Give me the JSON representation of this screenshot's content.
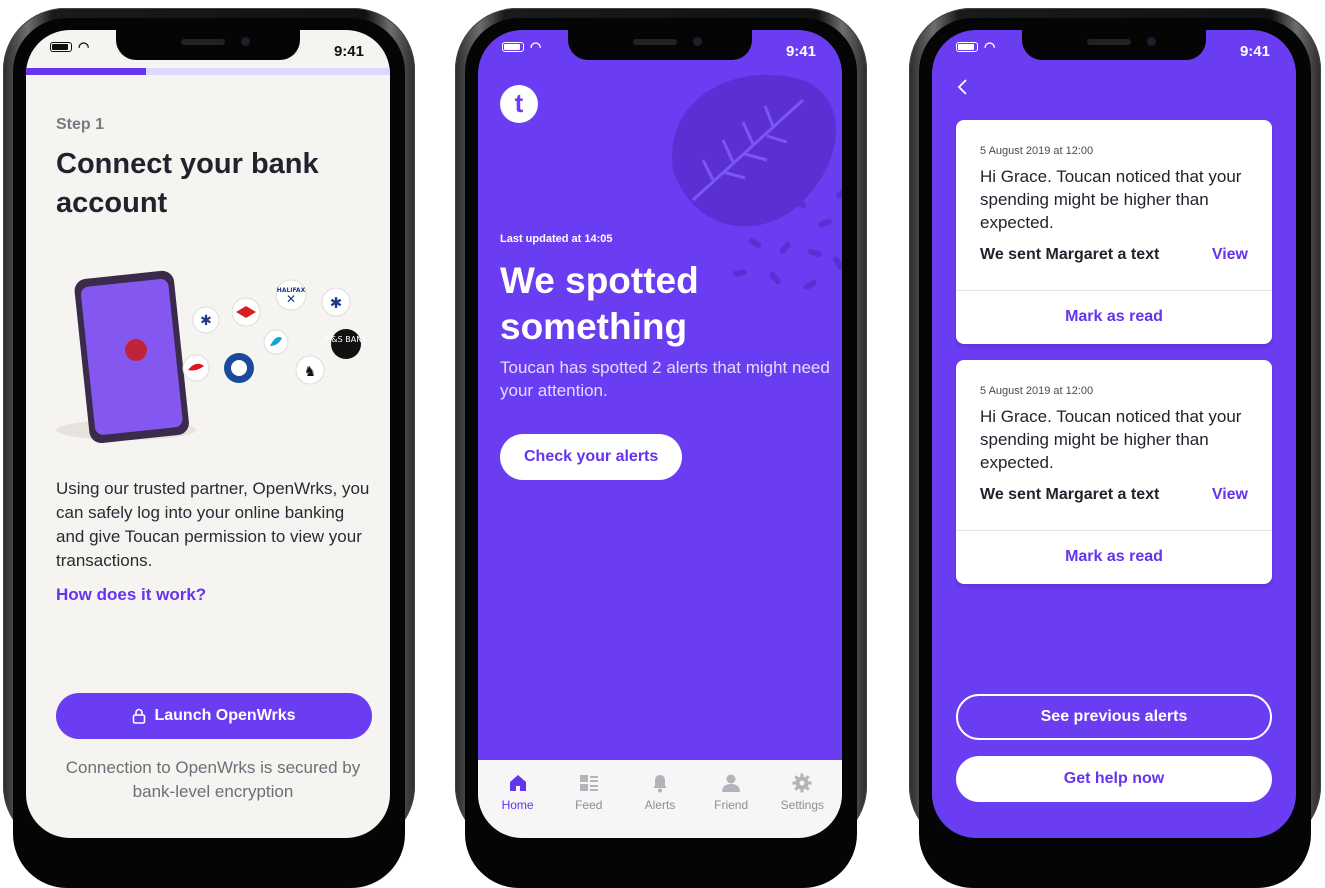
{
  "status_bar": {
    "time": "9:41"
  },
  "screen1": {
    "progress_percent": 33,
    "step": "Step 1",
    "title": "Connect your bank account",
    "body": "Using our trusted partner, OpenWrks, you can safely log into your online banking and give Toucan permission to view your transactions.",
    "link": "How does it work?",
    "button": "Launch OpenWrks",
    "footer": "Connection to OpenWrks is secured by bank-level encryption",
    "bank_logos": {
      "halifax": "HALIFAX",
      "ms_bank": "M&S BANK"
    },
    "colors": {
      "accent": "#6633ee",
      "background": "#f5f4f1"
    }
  },
  "screen2": {
    "logo_letter": "t",
    "last_updated": "Last updated at 14:05",
    "title": "We spotted something",
    "body": "Toucan has spotted 2 alerts that might need your attention.",
    "button": "Check your alerts",
    "tabs": [
      {
        "label": "Home",
        "icon": "home-icon",
        "active": true
      },
      {
        "label": "Feed",
        "icon": "feed-icon",
        "active": false
      },
      {
        "label": "Alerts",
        "icon": "bell-icon",
        "active": false
      },
      {
        "label": "Friend",
        "icon": "person-icon",
        "active": false
      },
      {
        "label": "Settings",
        "icon": "gear-icon",
        "active": false
      }
    ],
    "colors": {
      "background": "#6a3df2"
    }
  },
  "screen3": {
    "back_icon": "chevron-left-icon",
    "alerts": [
      {
        "date": "5 August 2019 at 12:00",
        "message": "Hi Grace. Toucan noticed that your spending might be higher than expected.",
        "action": "We sent Margaret a text",
        "view": "View",
        "mark_read": "Mark as read"
      },
      {
        "date": "5 August 2019 at 12:00",
        "message": "Hi Grace. Toucan noticed that your spending might be higher than expected.",
        "action": "We sent Margaret a text",
        "view": "View",
        "mark_read": "Mark as read"
      }
    ],
    "secondary_button": "See previous alerts",
    "primary_button": "Get help now"
  }
}
